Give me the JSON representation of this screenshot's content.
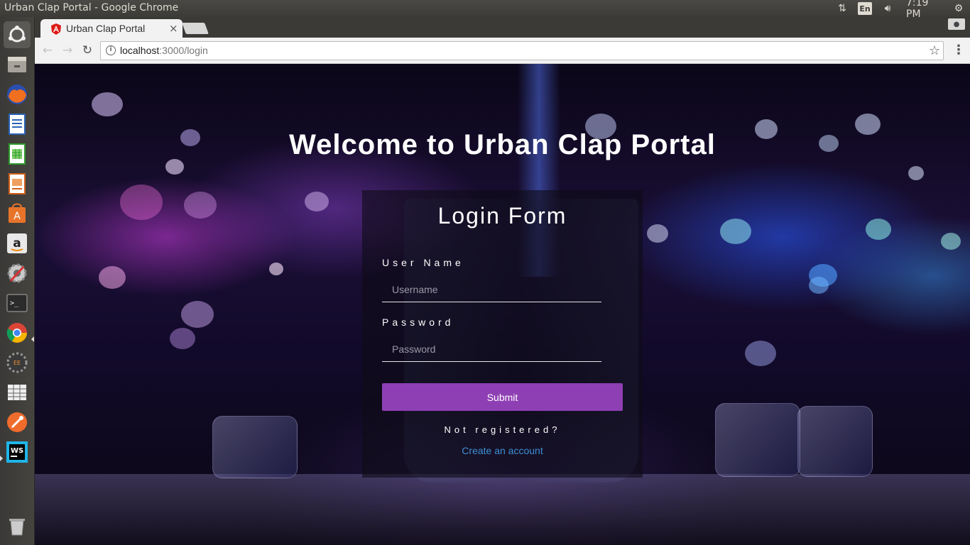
{
  "os": {
    "window_title": "Urban Clap Portal - Google Chrome",
    "language_indicator": "En",
    "clock": "7:19 PM",
    "tray_icons": [
      "network-icon",
      "keyboard-language-icon",
      "volume-icon",
      "settings-gear-icon"
    ]
  },
  "launcher": {
    "items": [
      {
        "name": "ubuntu-dash-icon"
      },
      {
        "name": "files-icon"
      },
      {
        "name": "firefox-icon"
      },
      {
        "name": "libreoffice-writer-icon"
      },
      {
        "name": "libreoffice-calc-icon"
      },
      {
        "name": "libreoffice-impress-icon"
      },
      {
        "name": "software-center-icon"
      },
      {
        "name": "amazon-icon"
      },
      {
        "name": "system-settings-icon"
      },
      {
        "name": "terminal-icon"
      },
      {
        "name": "chrome-icon"
      },
      {
        "name": "eclipse-java-ee-icon"
      },
      {
        "name": "workspace-switcher-icon"
      },
      {
        "name": "postman-icon"
      },
      {
        "name": "webstorm-icon"
      },
      {
        "name": "trash-icon"
      }
    ]
  },
  "browser": {
    "tab": {
      "title": "Urban Clap Portal",
      "close": "×"
    },
    "url": {
      "host": "localhost",
      "path": ":3000/login"
    },
    "nav": {
      "back": "←",
      "forward": "→",
      "reload": "↻",
      "star": "☆",
      "menu": "⋮",
      "info": "i"
    }
  },
  "page": {
    "heading": "Welcome to Urban Clap Portal",
    "form": {
      "title": "Login Form",
      "username_label": "User Name",
      "username_placeholder": "Username",
      "username_value": "",
      "password_label": "Password",
      "password_placeholder": "Password",
      "password_value": "",
      "submit_label": "Submit",
      "not_registered": "Not registered?",
      "create_account": "Create an account"
    }
  },
  "colors": {
    "submit_bg": "#8f3fb4",
    "link": "#3d8fd6",
    "panel_bg": "#3c3b37"
  }
}
